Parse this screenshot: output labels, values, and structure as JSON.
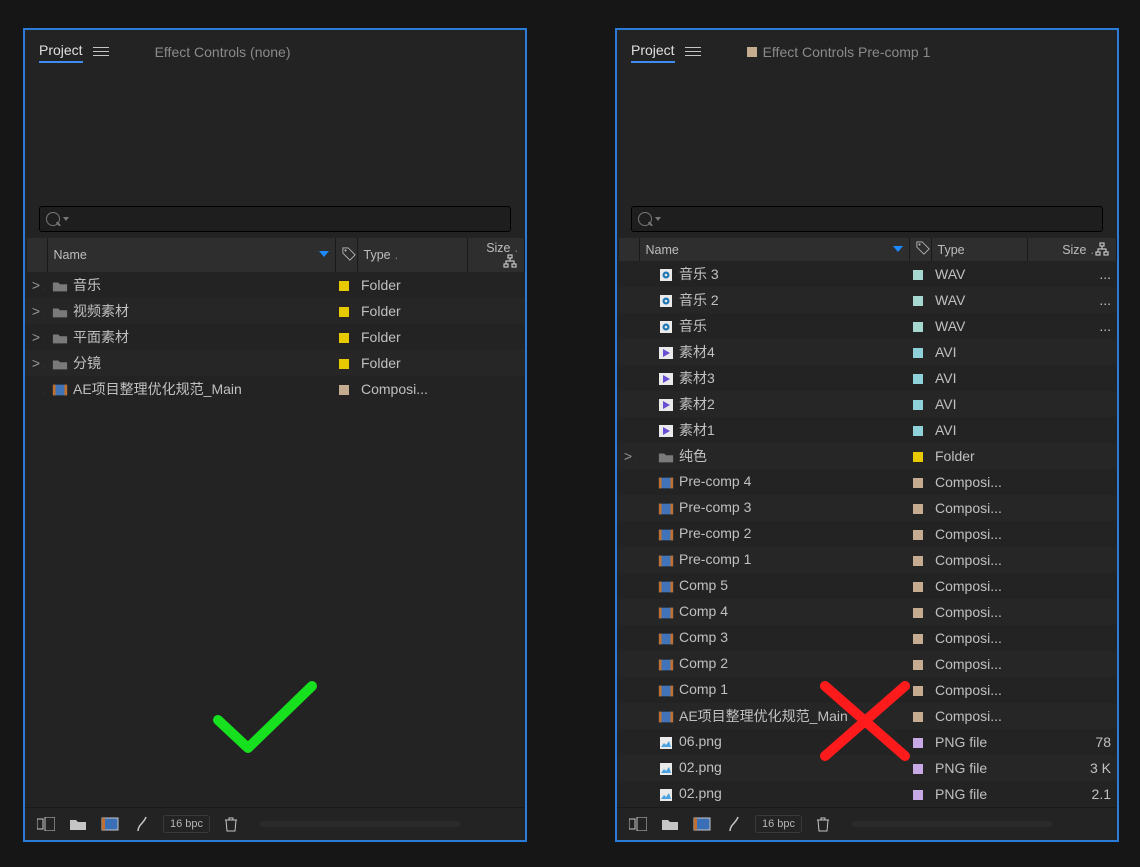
{
  "tabs": {
    "project": "Project",
    "effectControlsNone": "Effect Controls (none)",
    "effectControlsPrecomp": "Effect Controls Pre-comp 1"
  },
  "headers": {
    "name": "Name",
    "type": "Type",
    "size": "Size"
  },
  "footer": {
    "bpc": "16 bpc"
  },
  "colors": {
    "folder": "#e8c900",
    "comp": "#c5ab90",
    "wav": "#a7d8cf",
    "avi": "#8fd1d9",
    "png": "#c7a9e6"
  },
  "left": {
    "rows": [
      {
        "expand": ">",
        "icon": "folder",
        "name": "音乐",
        "swatch": "#e8c900",
        "type": "Folder"
      },
      {
        "expand": ">",
        "icon": "folder",
        "name": "视频素材",
        "swatch": "#e8c900",
        "type": "Folder"
      },
      {
        "expand": ">",
        "icon": "folder",
        "name": "平面素材",
        "swatch": "#e8c900",
        "type": "Folder"
      },
      {
        "expand": ">",
        "icon": "folder",
        "name": "分镜",
        "swatch": "#e8c900",
        "type": "Folder"
      },
      {
        "expand": " ",
        "icon": "comp",
        "name": "AE项目整理优化规范_Main",
        "swatch": "#c5ab90",
        "type": "Composi..."
      }
    ]
  },
  "right": {
    "rows": [
      {
        "indent": 1,
        "icon": "audio",
        "name": "音乐 3",
        "swatch": "#a7d8cf",
        "type": "WAV",
        "size": "..."
      },
      {
        "indent": 1,
        "icon": "audio",
        "name": "音乐 2",
        "swatch": "#a7d8cf",
        "type": "WAV",
        "size": "..."
      },
      {
        "indent": 1,
        "icon": "audio",
        "name": "音乐",
        "swatch": "#a7d8cf",
        "type": "WAV",
        "size": "..."
      },
      {
        "indent": 1,
        "icon": "video",
        "name": "素材4",
        "swatch": "#8fd1d9",
        "type": "AVI",
        "size": ""
      },
      {
        "indent": 1,
        "icon": "video",
        "name": "素材3",
        "swatch": "#8fd1d9",
        "type": "AVI",
        "size": ""
      },
      {
        "indent": 1,
        "icon": "video",
        "name": "素材2",
        "swatch": "#8fd1d9",
        "type": "AVI",
        "size": ""
      },
      {
        "indent": 1,
        "icon": "video",
        "name": "素材1",
        "swatch": "#8fd1d9",
        "type": "AVI",
        "size": ""
      },
      {
        "expand": ">",
        "indent": 1,
        "icon": "folder",
        "name": "纯色",
        "swatch": "#e8c900",
        "type": "Folder",
        "size": ""
      },
      {
        "indent": 1,
        "icon": "comp",
        "name": "Pre-comp 4",
        "swatch": "#c5ab90",
        "type": "Composi...",
        "size": ""
      },
      {
        "indent": 1,
        "icon": "comp",
        "name": "Pre-comp 3",
        "swatch": "#c5ab90",
        "type": "Composi...",
        "size": ""
      },
      {
        "indent": 1,
        "icon": "comp",
        "name": "Pre-comp 2",
        "swatch": "#c5ab90",
        "type": "Composi...",
        "size": ""
      },
      {
        "indent": 1,
        "icon": "comp",
        "name": "Pre-comp 1",
        "swatch": "#c5ab90",
        "type": "Composi...",
        "size": ""
      },
      {
        "indent": 1,
        "icon": "comp",
        "name": "Comp 5",
        "swatch": "#c5ab90",
        "type": "Composi...",
        "size": ""
      },
      {
        "indent": 1,
        "icon": "comp",
        "name": "Comp 4",
        "swatch": "#c5ab90",
        "type": "Composi...",
        "size": ""
      },
      {
        "indent": 1,
        "icon": "comp",
        "name": "Comp 3",
        "swatch": "#c5ab90",
        "type": "Composi...",
        "size": ""
      },
      {
        "indent": 1,
        "icon": "comp",
        "name": "Comp 2",
        "swatch": "#c5ab90",
        "type": "Composi...",
        "size": ""
      },
      {
        "indent": 1,
        "icon": "comp",
        "name": "Comp 1",
        "swatch": "#c5ab90",
        "type": "Composi...",
        "size": ""
      },
      {
        "indent": 1,
        "icon": "comp",
        "name": "AE项目整理优化规范_Main",
        "swatch": "#c5ab90",
        "type": "Composi...",
        "size": ""
      },
      {
        "indent": 1,
        "icon": "png",
        "name": "06.png",
        "swatch": "#c7a9e6",
        "type": "PNG file",
        "size": "78"
      },
      {
        "indent": 1,
        "icon": "png",
        "name": "02.png",
        "swatch": "#c7a9e6",
        "type": "PNG file",
        "size": "3 K"
      },
      {
        "indent": 1,
        "icon": "png",
        "name": "02.png",
        "swatch": "#c7a9e6",
        "type": "PNG file",
        "size": "2.1"
      }
    ]
  }
}
